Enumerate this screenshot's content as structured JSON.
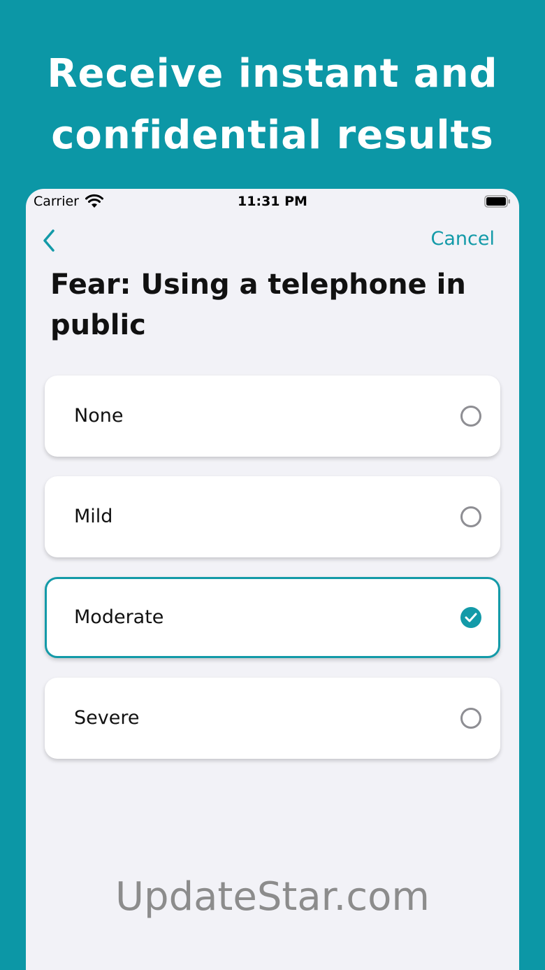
{
  "hero": {
    "line1": "Receive instant and",
    "line2": "confidential results"
  },
  "status_bar": {
    "carrier": "Carrier",
    "time": "11:31 PM"
  },
  "nav": {
    "cancel_label": "Cancel"
  },
  "question": {
    "title": "Fear: Using a telephone in public"
  },
  "options": [
    {
      "label": "None",
      "selected": false
    },
    {
      "label": "Mild",
      "selected": false
    },
    {
      "label": "Moderate",
      "selected": true
    },
    {
      "label": "Severe",
      "selected": false
    }
  ],
  "watermark": "UpdateStar.com",
  "colors": {
    "background": "#0c97a6",
    "accent": "#139aa8",
    "card": "#ffffff",
    "screen": "#f2f2f7"
  },
  "icons": [
    "wifi-icon",
    "battery-icon",
    "chevron-left-icon",
    "radio-unchecked-icon",
    "checkmark-circle-icon"
  ]
}
